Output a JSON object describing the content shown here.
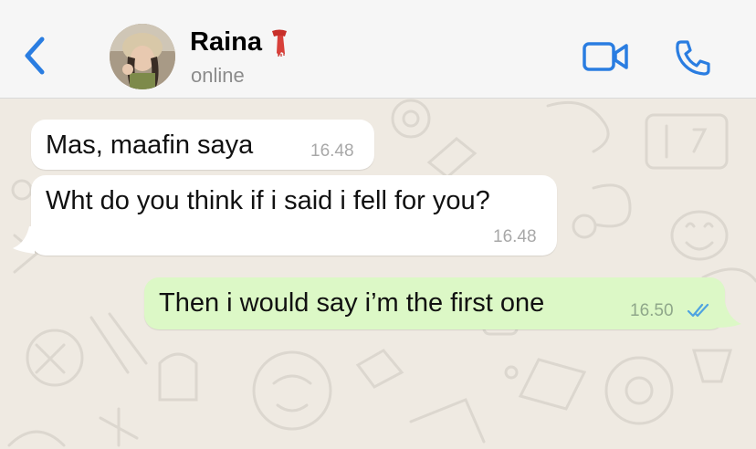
{
  "header": {
    "contact_name": "Raina",
    "status": "online",
    "accent_color": "#2a7de1",
    "avatar_icon": "profile-photo",
    "name_emoji_icon": "scarf-icon",
    "back_icon": "chevron-left-icon",
    "video_icon": "video-camera-icon",
    "call_icon": "phone-icon"
  },
  "messages": [
    {
      "direction": "incoming",
      "text": "Mas, maafin saya",
      "time": "16.48"
    },
    {
      "direction": "incoming",
      "text": "Wht do you think if i said i fell for you?",
      "time": "16.48"
    },
    {
      "direction": "outgoing",
      "text": "Then i would say i’m the first one",
      "time": "16.50",
      "status_icon": "double-check-icon"
    }
  ],
  "colors": {
    "incoming_bubble": "#ffffff",
    "outgoing_bubble": "#dcf8c6",
    "chat_background": "#efeae2",
    "read_ticks": "#4fa3e0"
  }
}
